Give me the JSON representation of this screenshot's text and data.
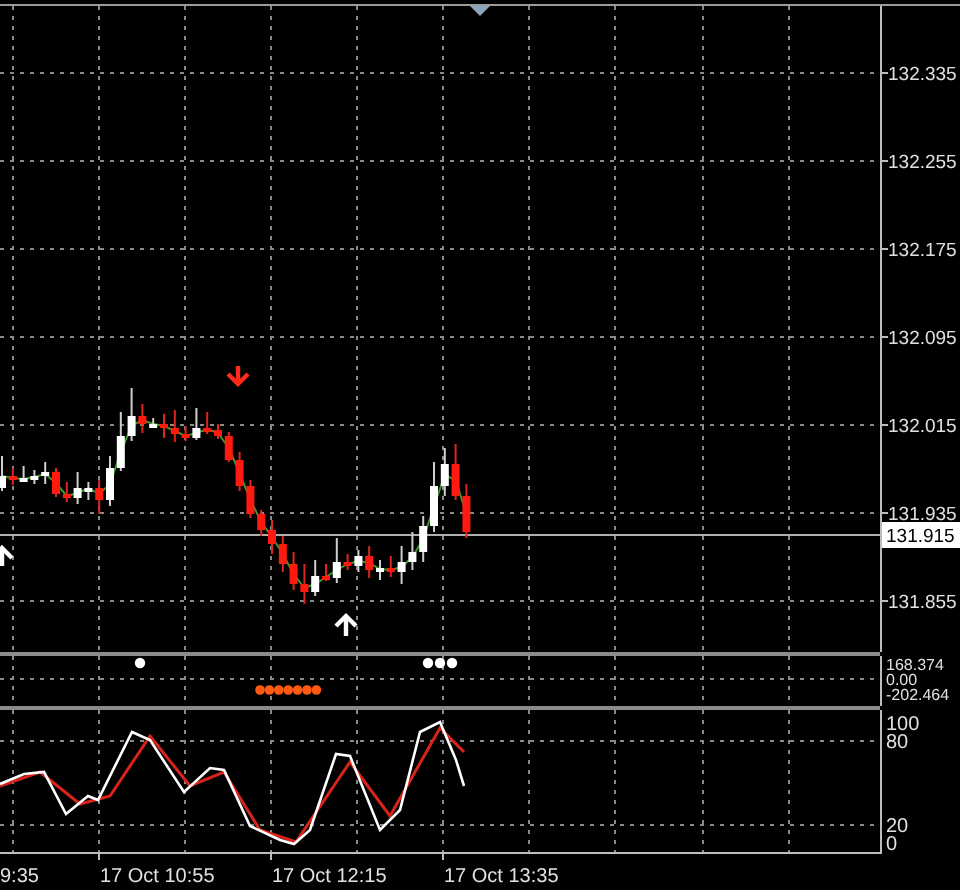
{
  "price_axis": {
    "labels": [
      "132.335",
      "132.255",
      "132.175",
      "132.095",
      "132.015",
      "131.935",
      "131.855"
    ],
    "current_price": "131.915"
  },
  "indicator_pane": {
    "labels": [
      "168.374",
      "0.00",
      "-202.464"
    ]
  },
  "stochastic_pane": {
    "labels": [
      "100",
      "80",
      "20",
      "0"
    ]
  },
  "time_axis": {
    "labels": [
      "9:35",
      "17 Oct 10:55",
      "17 Oct 12:15",
      "17 Oct 13:35"
    ]
  }
}
